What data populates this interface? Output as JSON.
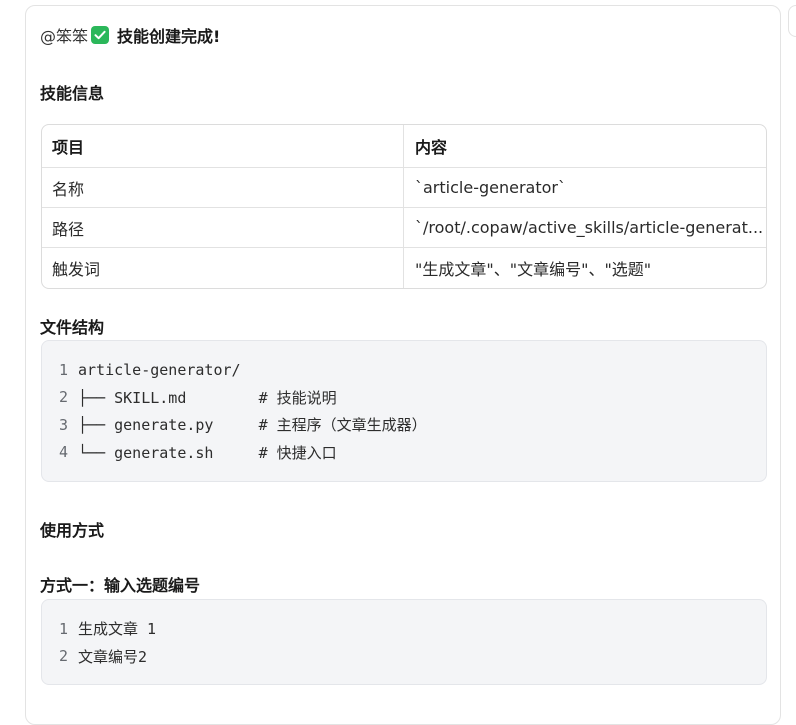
{
  "message": {
    "mention": "@笨笨",
    "title": "技能创建完成!"
  },
  "skill_info": {
    "heading": "技能信息",
    "columns": [
      "项目",
      "内容"
    ],
    "rows": [
      [
        "名称",
        "`article-generator`"
      ],
      [
        "路径",
        "`/root/.copaw/active_skills/article-generat..."
      ],
      [
        "触发词",
        "\"生成文章\"、\"文章编号\"、\"选题\""
      ]
    ]
  },
  "file_structure": {
    "heading": "文件结构",
    "line_numbers": [
      "1",
      "2",
      "3",
      "4"
    ],
    "lines": [
      "article-generator/",
      "├── SKILL.md        # 技能说明",
      "├── generate.py     # 主程序（文章生成器）",
      "└── generate.sh     # 快捷入口"
    ]
  },
  "usage": {
    "heading": "使用方式",
    "method1_heading": "方式一：输入选题编号",
    "line_numbers": [
      "1",
      "2"
    ],
    "lines": [
      "生成文章 1",
      "文章编号2"
    ]
  },
  "colors": {
    "check_green": "#2bb75a",
    "code_bg": "#f4f5f7",
    "border": "#e3e3e3"
  },
  "icons": {
    "check": "check-icon"
  }
}
